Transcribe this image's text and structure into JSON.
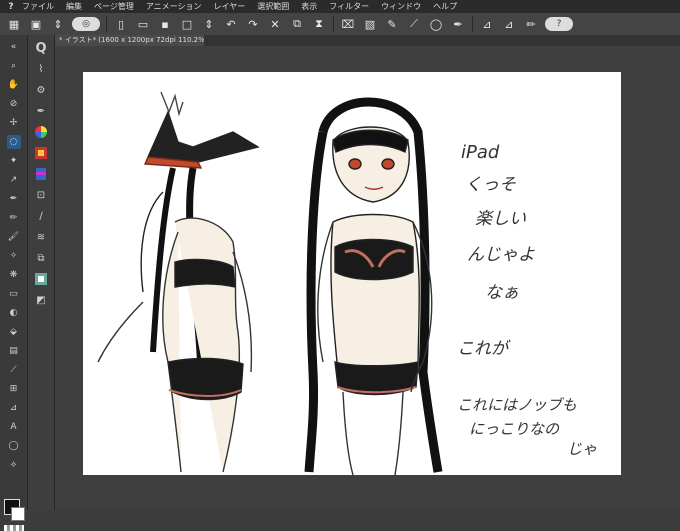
{
  "menu": {
    "items": [
      "ファイル",
      "編集",
      "ページ管理",
      "アニメーション",
      "レイヤー",
      "選択範囲",
      "表示",
      "フィルター",
      "ウィンドウ",
      "ヘルプ"
    ]
  },
  "document": {
    "tab_title": "* イラスト* (1600 x 1200px 72dpi 110.2%)"
  },
  "canvas_text": {
    "line1": "iPad",
    "line2": "くっそ",
    "line3": "楽しい",
    "line4": "んじゃよ",
    "line5": "なぁ",
    "line6": "これが",
    "line7": "これにはノッブも",
    "line8": "にっこりなの",
    "line9": "じゃ"
  },
  "colors": {
    "main": "#111111",
    "sub": "#ffffff",
    "accent": "#2e5b8a"
  }
}
